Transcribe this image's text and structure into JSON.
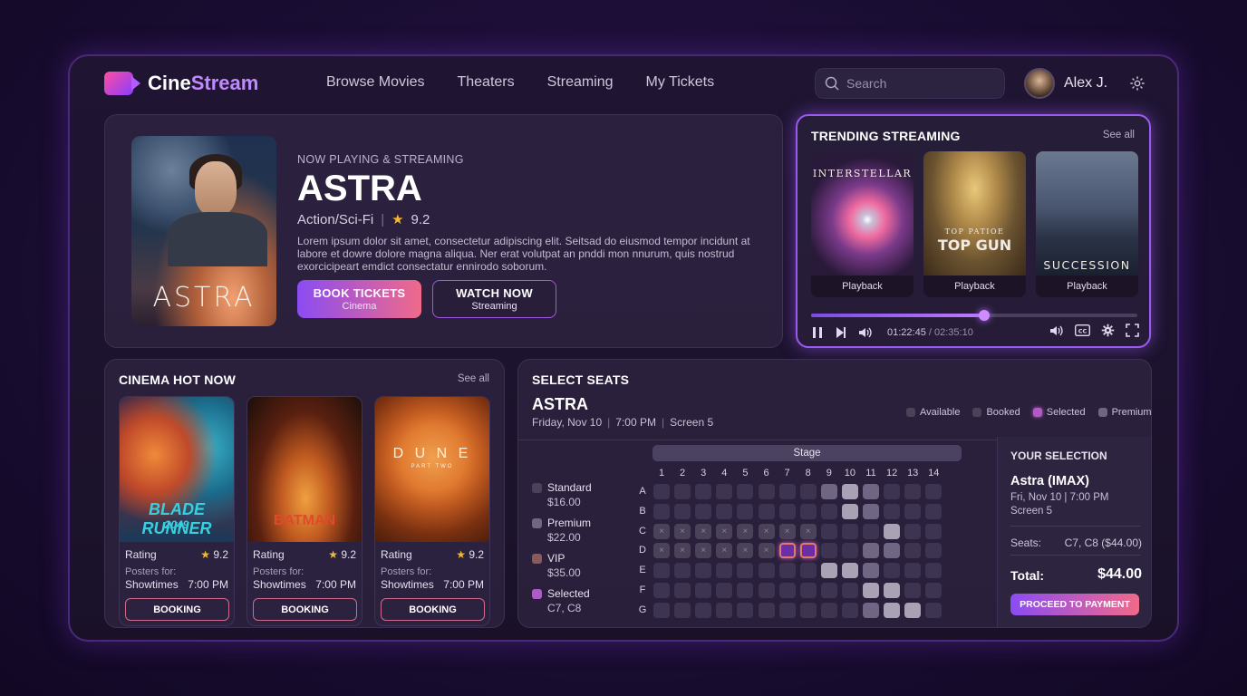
{
  "app": {
    "brand_a": "Cine",
    "brand_b": "Stream"
  },
  "nav": [
    "Browse Movies",
    "Theaters",
    "Streaming",
    "My Tickets"
  ],
  "search": {
    "placeholder": "Search"
  },
  "user": {
    "name": "Alex J."
  },
  "hero": {
    "kicker": "NOW PLAYING & STREAMING",
    "title": "ASTRA",
    "poster_title": "ASTRA",
    "genre": "Action/Sci-Fi",
    "rating": "9.2",
    "description": "Lorem ipsum dolor sit amet, consectetur adipiscing elit. Seitsad do eiusmod tempor incidunt at labore et dowre dolore magna aliqua. Ner erat volutpat an pnddi mon nnurum, quis nostrud exorcicipeart emdict consectatur ennirodo soborum.",
    "btn_book": {
      "label": "BOOK TICKETS",
      "sub": "Cinema"
    },
    "btn_watch": {
      "label": "WATCH NOW",
      "sub": "Streaming"
    }
  },
  "trending": {
    "title": "TRENDING STREAMING",
    "see_all": "See all",
    "items": [
      {
        "art_title": "INTERSTELLAR",
        "caption": "Playback"
      },
      {
        "art_title": "TOP GUN",
        "art_sub": "TOP PATIOE",
        "caption": "Playback"
      },
      {
        "art_title": "SUCCESSION",
        "caption": "Playback"
      }
    ],
    "player": {
      "current": "01:22:45",
      "total": "02:35:10",
      "progress": 0.53
    }
  },
  "cinema": {
    "title": "CINEMA HOT NOW",
    "see_all": "See all",
    "cards": [
      {
        "art_title": "BLADE RUNNER",
        "art_sub": "2049",
        "rating_label": "Rating",
        "rating": "9.2",
        "posters_label": "Posters for:",
        "showtimes_label": "Showtimes",
        "time": "7:00 PM",
        "button": "BOOKING"
      },
      {
        "art_title": "BATMAN",
        "rating_label": "Rating",
        "rating": "9.2",
        "posters_label": "Posters for:",
        "showtimes_label": "Showtimes",
        "time": "7:00 PM",
        "button": "BOOKING"
      },
      {
        "art_title": "D U N E",
        "art_sub": "PART TWO",
        "rating_label": "Rating",
        "rating": "9.2",
        "posters_label": "Posters for:",
        "showtimes_label": "Showtimes",
        "time": "7:00 PM",
        "button": "BOOKING"
      }
    ]
  },
  "seats": {
    "title": "SELECT SEATS",
    "movie": "ASTRA",
    "date": "Friday, Nov 10",
    "time": "7:00 PM",
    "screen": "Screen 5",
    "legend": [
      {
        "label": "Available",
        "color": "#4a4258"
      },
      {
        "label": "Booked",
        "color": "#4a4258"
      },
      {
        "label": "Selected",
        "color": "#b05ac8"
      },
      {
        "label": "Premium",
        "color": "#6e6682"
      }
    ],
    "prices": [
      {
        "name": "Standard",
        "value": "$16.00",
        "color": "#4a4258"
      },
      {
        "name": "Premium",
        "value": "$22.00",
        "color": "#6e6682"
      },
      {
        "name": "VIP",
        "value": "$35.00",
        "color": "#8a5a5a"
      },
      {
        "name": "Selected",
        "value": "C7, C8",
        "color": "#b05ac8"
      }
    ],
    "stage": "Stage",
    "columns": [
      "1",
      "2",
      "3",
      "4",
      "5",
      "6",
      "7",
      "8",
      "9",
      "10",
      "11",
      "12",
      "13",
      "14"
    ],
    "rows": [
      "A",
      "B",
      "C",
      "D",
      "E",
      "F",
      "G"
    ],
    "booked": [
      "C1",
      "C2",
      "C3",
      "C4",
      "C5",
      "C6",
      "C7",
      "C8",
      "D1",
      "D2",
      "D3",
      "D4",
      "D5",
      "D6"
    ],
    "selected": [
      "D7",
      "D8"
    ],
    "premium": [
      "A9",
      "A10",
      "A11",
      "B10",
      "B11",
      "C12",
      "D11",
      "D12",
      "E10",
      "E11",
      "F11",
      "F12",
      "G11",
      "G12",
      "G13"
    ],
    "premium_light": [
      "B10",
      "E9",
      "E10",
      "F11",
      "G12",
      "G13",
      "A10",
      "C12",
      "F12"
    ]
  },
  "selection": {
    "title": "YOUR SELECTION",
    "movie": "Astra (IMAX)",
    "date_line": "Fri, Nov 10 | 7:00 PM",
    "screen": "Screen 5",
    "seats_label": "Seats:",
    "seats_value": "C7, C8 ($44.00)",
    "total_label": "Total:",
    "total_value": "$44.00",
    "pay_button": "PROCEED TO PAYMENT"
  }
}
